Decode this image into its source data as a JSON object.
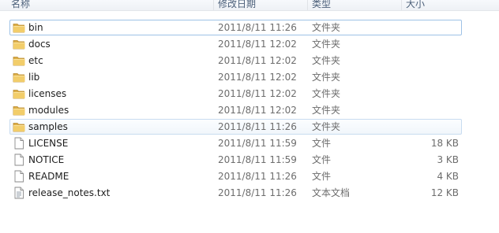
{
  "columns": {
    "name": "名称",
    "date": "修改日期",
    "type": "类型",
    "size": "大小"
  },
  "files": [
    {
      "name": "bin",
      "date": "2011/8/11 11:26",
      "type": "文件夹",
      "size": "",
      "icon": "folder-icon"
    },
    {
      "name": "docs",
      "date": "2011/8/11 12:02",
      "type": "文件夹",
      "size": "",
      "icon": "folder-icon"
    },
    {
      "name": "etc",
      "date": "2011/8/11 12:02",
      "type": "文件夹",
      "size": "",
      "icon": "folder-icon"
    },
    {
      "name": "lib",
      "date": "2011/8/11 12:02",
      "type": "文件夹",
      "size": "",
      "icon": "folder-icon"
    },
    {
      "name": "licenses",
      "date": "2011/8/11 12:02",
      "type": "文件夹",
      "size": "",
      "icon": "folder-icon"
    },
    {
      "name": "modules",
      "date": "2011/8/11 12:02",
      "type": "文件夹",
      "size": "",
      "icon": "folder-icon"
    },
    {
      "name": "samples",
      "date": "2011/8/11 11:26",
      "type": "文件夹",
      "size": "",
      "icon": "folder-icon"
    },
    {
      "name": "LICENSE",
      "date": "2011/8/11 11:59",
      "type": "文件",
      "size": "18 KB",
      "icon": "file-icon"
    },
    {
      "name": "NOTICE",
      "date": "2011/8/11 11:59",
      "type": "文件",
      "size": "3 KB",
      "icon": "file-icon"
    },
    {
      "name": "README",
      "date": "2011/8/11 11:26",
      "type": "文件",
      "size": "4 KB",
      "icon": "file-icon"
    },
    {
      "name": "release_notes.txt",
      "date": "2011/8/11 11:26",
      "type": "文本文档",
      "size": "12 KB",
      "icon": "text-file-icon"
    }
  ]
}
